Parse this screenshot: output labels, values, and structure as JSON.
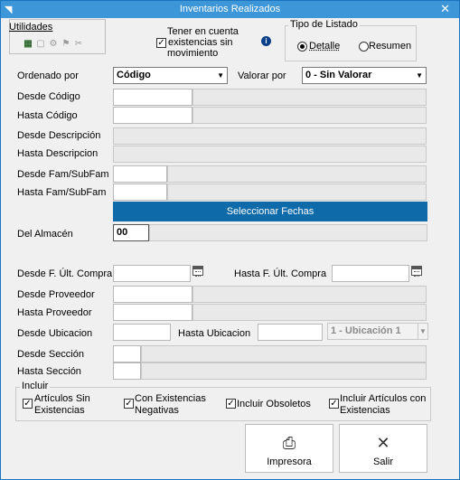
{
  "window": {
    "title": "Inventarios Realizados",
    "close_glyph": "✕",
    "sys_glyph": "◥"
  },
  "menu": {
    "utilidades": "Utilidades"
  },
  "toolbar": {
    "icons": [
      "▦",
      "▢",
      "⚙",
      "⚑",
      "✂"
    ]
  },
  "existencias": {
    "label_line1": "Tener en cuenta",
    "label_line2": "existencias sin",
    "label_line3": "movimiento",
    "checked": true
  },
  "tipo_listado": {
    "title": "Tipo de Listado",
    "detalle": "Detalle",
    "resumen": "Resumen",
    "selected": "Detalle"
  },
  "ordenado": {
    "label": "Ordenado por",
    "value": "Código"
  },
  "valorar": {
    "label": "Valorar por",
    "value": "0 - Sin Valorar"
  },
  "fields": {
    "desde_codigo": "Desde Código",
    "hasta_codigo": "Hasta Código",
    "desde_descripcion": "Desde Descripción",
    "hasta_descripcion": "Hasta Descripcion",
    "desde_fam": "Desde Fam/SubFam",
    "hasta_fam": "Hasta Fam/SubFam",
    "del_almacen": "Del Almacén",
    "almacen_value": "00",
    "desde_f_compra": "Desde F. Últ. Compra",
    "hasta_f_compra": "Hasta F. Últ. Compra",
    "desde_proveedor": "Desde Proveedor",
    "hasta_proveedor": "Hasta Proveedor",
    "desde_ubicacion": "Desde Ubicacion",
    "hasta_ubicacion": "Hasta Ubicacion",
    "ubicacion_select": "1 - Ubicación 1",
    "desde_seccion": "Desde Sección",
    "hasta_seccion": "Hasta Sección"
  },
  "seleccionar_fechas": "Seleccionar Fechas",
  "incluir": {
    "title": "Incluir",
    "sin_exist_1": "Artículos Sin",
    "sin_exist_2": "Existencias",
    "neg_1": "Con Existencias",
    "neg_2": "Negativas",
    "obsoletos": "Incluir Obsoletos",
    "con_exist_1": "Incluir Artículos con",
    "con_exist_2": "Existencias"
  },
  "buttons": {
    "impresora": "Impresora",
    "salir": "Salir"
  }
}
